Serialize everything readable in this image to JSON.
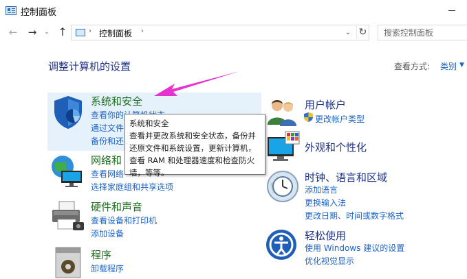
{
  "window": {
    "title": "控制面板"
  },
  "nav": {
    "back": "←",
    "forward": "→",
    "recent": "⌄",
    "up": "↑",
    "address_root_sep": "›",
    "address_location": "控制面板",
    "address_sep2": "›",
    "refresh": "↻",
    "dropdown": "⌄",
    "search_placeholder": "搜索控制面板"
  },
  "page": {
    "title": "调整计算机的设置",
    "view_label": "查看方式:",
    "view_value": "类别",
    "view_chevron": "▼"
  },
  "left": [
    {
      "title": "系统和安全",
      "links": [
        "查看你的计算机状态",
        "通过文件",
        "备份和还"
      ]
    },
    {
      "title": "网络和",
      "links": [
        "查看网络",
        "选择家庭组和共享选项"
      ]
    },
    {
      "title": "硬件和声音",
      "links": [
        "查看设备和打印机",
        "添加设备"
      ]
    },
    {
      "title": "程序",
      "links": [
        "卸载程序"
      ]
    }
  ],
  "right": [
    {
      "title": "用户帐户",
      "links": [
        "更改帐户类型"
      ]
    },
    {
      "title": "外观和个性化",
      "links": []
    },
    {
      "title": "时钟、语言和区域",
      "links": [
        "添加语言",
        "更换输入法",
        "更改日期、时间或数字格式"
      ]
    },
    {
      "title": "轻松使用",
      "links": [
        "使用 Windows 建议的设置",
        "优化视觉显示"
      ]
    }
  ],
  "tooltip": {
    "lines": [
      "系统和安全",
      "查看并更改系统和安全状态，备份并",
      "还原文件和系统设置，更新计算机，",
      "查看 RAM 和处理器速度和检查防火",
      "墙，等等。"
    ]
  },
  "colors": {
    "link": "#1e64c8",
    "category_title": "#1e6e1e",
    "highlight": "#e5f1fb",
    "arrow": "#e633d0"
  }
}
